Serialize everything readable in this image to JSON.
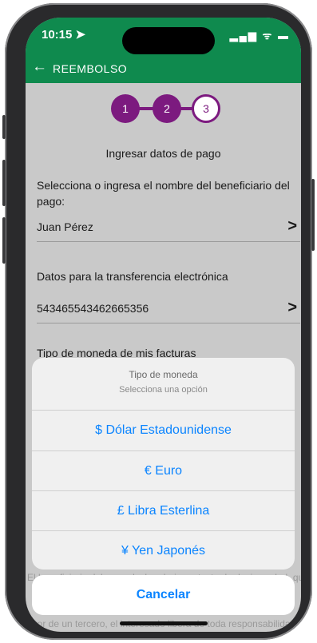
{
  "status": {
    "time": "10:15 ➤",
    "icons": "▂▄▆ ᯤ ▬"
  },
  "appbar": {
    "back_icon": "←",
    "title": "REEMBOLSO"
  },
  "steps": [
    "1",
    "2",
    "3"
  ],
  "heading": "Ingresar datos de pago",
  "beneficiary": {
    "label": "Selecciona o ingresa el nombre del beneficiario del pago:",
    "value": "Juan Pérez"
  },
  "transfer": {
    "label": "Datos para la transferencia electrónica",
    "value": "543465543462665356"
  },
  "currency_label": "Tipo de moneda de mis facturas",
  "chevron": ">",
  "fineprint": {
    "line1": "El beneficiario del pago declara bajo protesta de decir verdad, que",
    "line2": "avor de un tercero, el interesado libera de toda responsabilidad"
  },
  "sheet": {
    "title": "Tipo de moneda",
    "subtitle": "Selecciona una opción",
    "options": [
      "$ Dólar Estadounidense",
      "€ Euro",
      "£ Libra Esterlina",
      "¥ Yen Japonés"
    ],
    "cancel": "Cancelar"
  },
  "colors": {
    "brand_green": "#0f8a4e",
    "step_purple": "#7c1a7f",
    "ios_blue": "#0a84ff"
  }
}
